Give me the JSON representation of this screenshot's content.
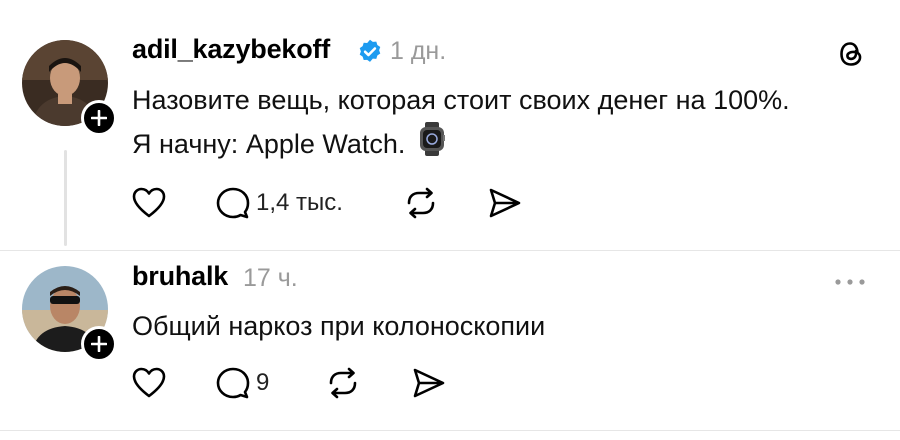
{
  "post": {
    "username": "adil_kazybekoff",
    "time": "1 дн.",
    "text_line1": "Назовите вещь, которая стоит своих денег на 100%.",
    "text_line2": "Я начну: Apple Watch.",
    "replies_count": "1,4 тыс."
  },
  "reply": {
    "username": "bruhalk",
    "time": "17 ч.",
    "text": "Общий наркоз при колоноскопии",
    "replies_count": "9"
  },
  "colors": {
    "verified": "#1d9bf0",
    "meta_gray": "#9a9a9a"
  },
  "icons": [
    "threads-logo-icon",
    "verified-badge-icon",
    "watch-emoji-icon",
    "heart-icon",
    "comment-icon",
    "repost-icon",
    "share-icon",
    "more-icon",
    "follow-plus-icon"
  ]
}
